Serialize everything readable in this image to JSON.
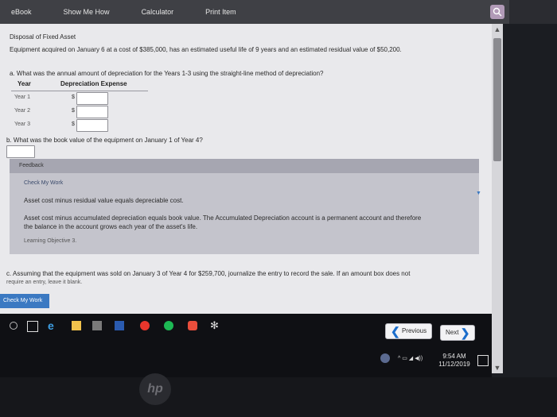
{
  "tabs": [
    "eBook",
    "Show Me How",
    "Calculator",
    "Print Item"
  ],
  "page": {
    "title": "Disposal of Fixed Asset",
    "intro": "Equipment acquired on January 6 at a cost of $385,000, has an estimated useful life of 9 years and an estimated residual value of $50,200.",
    "qa": "a. What was the annual amount of depreciation for the Years 1-3 using the straight-line method of depreciation?",
    "table_headers": [
      "Year",
      "Depreciation Expense"
    ],
    "rows": [
      {
        "label": "Year 1",
        "currency": "$"
      },
      {
        "label": "Year 2",
        "currency": "$"
      },
      {
        "label": "Year 3",
        "currency": "$"
      }
    ],
    "qb": "b. What was the book value of the equipment on January 1 of Year 4?",
    "qb_currency": "$",
    "feedback_title": "Feedback",
    "check_my_work": "Check My Work",
    "fb_line1": "Asset cost minus residual value equals depreciable cost.",
    "fb_line2": "Asset cost minus accumulated depreciation equals book value. The Accumulated Depreciation account is a permanent account and therefore",
    "fb_line3": "the balance in the account grows each year of the asset's life.",
    "learning_objective": "Learning Objective 3.",
    "qc": "c. Assuming that the equipment was sold on January 3 of Year 4 for $259,700, journalize the entry to record the sale. If an amount box does not",
    "qc2": "require an entry, leave it blank.",
    "check_btn": "Check My Work",
    "previous": "Previous",
    "next": "Next"
  },
  "clock": {
    "time": "9:54 AM",
    "date": "11/12/2019"
  },
  "colors": {
    "accent": "#3b79c2",
    "feedback_bg": "#c4c4cc",
    "search_btn": "#b19ab7"
  }
}
